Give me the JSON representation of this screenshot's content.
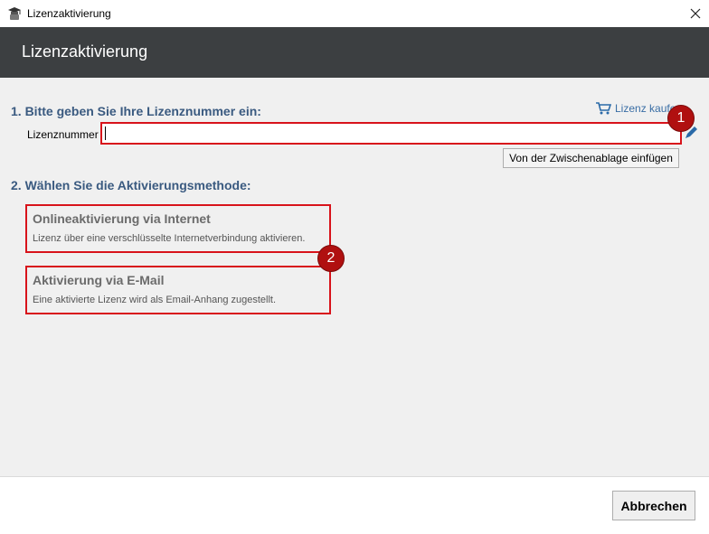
{
  "window": {
    "title": "Lizenzaktivierung",
    "app_icon": "graduation-cap-icon",
    "close_icon": "close-icon"
  },
  "header": {
    "title": "Lizenzaktivierung",
    "background": "#3c3f41"
  },
  "step1": {
    "heading": "1. Bitte geben Sie Ihre Lizenznummer ein:",
    "buy_label": "Lizenz kaufen",
    "buy_icon": "cart-icon",
    "field_label": "Lizenznummer",
    "field_value": "",
    "edit_icon": "pencil-icon",
    "paste_button": "Von der Zwischenablage einfügen"
  },
  "step2": {
    "heading": "2. Wählen Sie die Aktivierungsmethode:",
    "methods": [
      {
        "title": "Onlineaktivierung via Internet",
        "description": "Lizenz über eine verschlüsselte Internetverbindung aktivieren."
      },
      {
        "title": "Aktivierung via E-Mail",
        "description": "Eine aktivierte Lizenz wird als Email-Anhang zugestellt."
      }
    ]
  },
  "annotations": {
    "badge1": "1",
    "badge2": "2",
    "highlight_color": "#d8131b"
  },
  "footer": {
    "cancel_button": "Abbrechen"
  },
  "colors": {
    "heading": "#3a5a80",
    "link": "#3a6ea5",
    "content_bg": "#f0f0f0"
  }
}
